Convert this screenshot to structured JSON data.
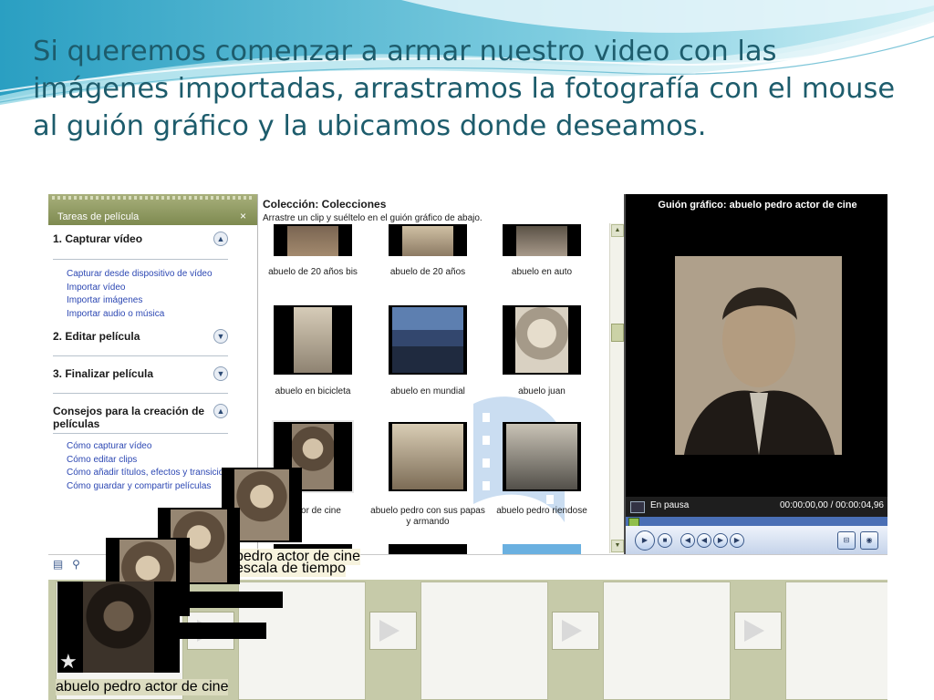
{
  "slide": {
    "text": "Si queremos comenzar a armar nuestro video con las imágenes importadas, arrastramos la fotografía con el mouse al guión gráfico y la ubicamos donde deseamos."
  },
  "tasks": {
    "header": "Tareas de película",
    "close_icon": "×",
    "sections": [
      {
        "title": "1. Capturar vídeo",
        "expanded": true,
        "links": [
          "Capturar desde dispositivo de vídeo",
          "Importar vídeo",
          "Importar imágenes",
          "Importar audio o música"
        ]
      },
      {
        "title": "2. Editar película",
        "expanded": false,
        "links": []
      },
      {
        "title": "3. Finalizar película",
        "expanded": false,
        "links": []
      },
      {
        "title": "Consejos para la creación de películas",
        "expanded": true,
        "links": [
          "Cómo capturar vídeo",
          "Cómo editar clips",
          "Cómo añadir títulos, efectos y transicio",
          "Cómo guardar y compartir películas"
        ]
      }
    ]
  },
  "collection": {
    "title": "Colección: Colecciones",
    "instructions": "Arrastre un clip y suéltelo en el guión gráfico de abajo.",
    "items": [
      {
        "label": "abuelo de 20 años bis"
      },
      {
        "label": "abuelo de 20 años"
      },
      {
        "label": "abuelo en auto"
      },
      {
        "label": "abuelo en bicicleta"
      },
      {
        "label": "abuelo en mundial"
      },
      {
        "label": "abuelo juan"
      },
      {
        "label": "ro actor de cine"
      },
      {
        "label": "abuelo pedro con sus papas y armando"
      },
      {
        "label": "abuelo pedro riendose"
      }
    ]
  },
  "preview": {
    "title": "Guión gráfico: abuelo pedro actor de cine",
    "state": "En pausa",
    "time": "00:00:00,00 / 00:00:04,96"
  },
  "storyboard": {
    "drag_captions": {
      "c1": "pedro actor de cine",
      "c1b": "escala de tiempo",
      "c2": "o actor de cine",
      "c3": "abuelo pedro actor de cine",
      "c4": "abuelo pedro actor de cine"
    }
  },
  "icons": {
    "chevron_up": "⌃",
    "chevron_down": "⌄",
    "star": "★"
  },
  "colors": {
    "title_text": "#1d5c6c",
    "link": "#2d48b3",
    "pane_header": "#8b9660",
    "storyboard_bg": "#c6caa9"
  }
}
